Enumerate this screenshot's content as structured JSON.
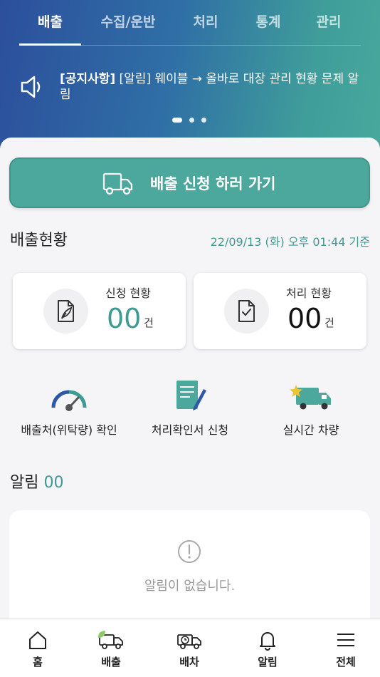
{
  "header": {
    "tabs": [
      {
        "label": "배출",
        "active": true
      },
      {
        "label": "수집/운반",
        "active": false
      },
      {
        "label": "처리",
        "active": false
      },
      {
        "label": "통계",
        "active": false
      },
      {
        "label": "관리",
        "active": false
      }
    ],
    "notice": {
      "tag": "[공지사항]",
      "text": " [알림] 웨이블 → 올바로  대장  관리 현황 문제 알림"
    },
    "carousel": {
      "total": 3,
      "active_index": 0
    }
  },
  "main": {
    "cta_label": "배출 신청 하러 가기",
    "status_title": "배출현황",
    "timestamp": "22/09/13 (화) 오후 01:44 기준",
    "stats": [
      {
        "label": "신청 현황",
        "value": "00",
        "unit": "건",
        "color": "#3d9b92"
      },
      {
        "label": "처리 현황",
        "value": "00",
        "unit": "건",
        "color": "#111111"
      }
    ],
    "quick_menu": [
      {
        "label": "배출처(위탁량) 확인",
        "icon": "gauge-icon"
      },
      {
        "label": "처리확인서 신청",
        "icon": "document-pen-icon"
      },
      {
        "label": "실시간 차량",
        "icon": "truck-star-icon"
      }
    ],
    "alarm": {
      "title": "알림",
      "count": "00",
      "empty_text": "알림이 없습니다."
    }
  },
  "bottom_nav": [
    {
      "label": "홈",
      "icon": "home-icon"
    },
    {
      "label": "배출",
      "icon": "truck-leaf-icon"
    },
    {
      "label": "배차",
      "icon": "truck-clock-icon"
    },
    {
      "label": "알림",
      "icon": "bell-icon"
    },
    {
      "label": "전체",
      "icon": "menu-icon"
    }
  ],
  "colors": {
    "accent": "#4ca79c",
    "accent_text": "#3d9b92",
    "header_start": "#2c4f9c",
    "header_end": "#48a89d"
  }
}
